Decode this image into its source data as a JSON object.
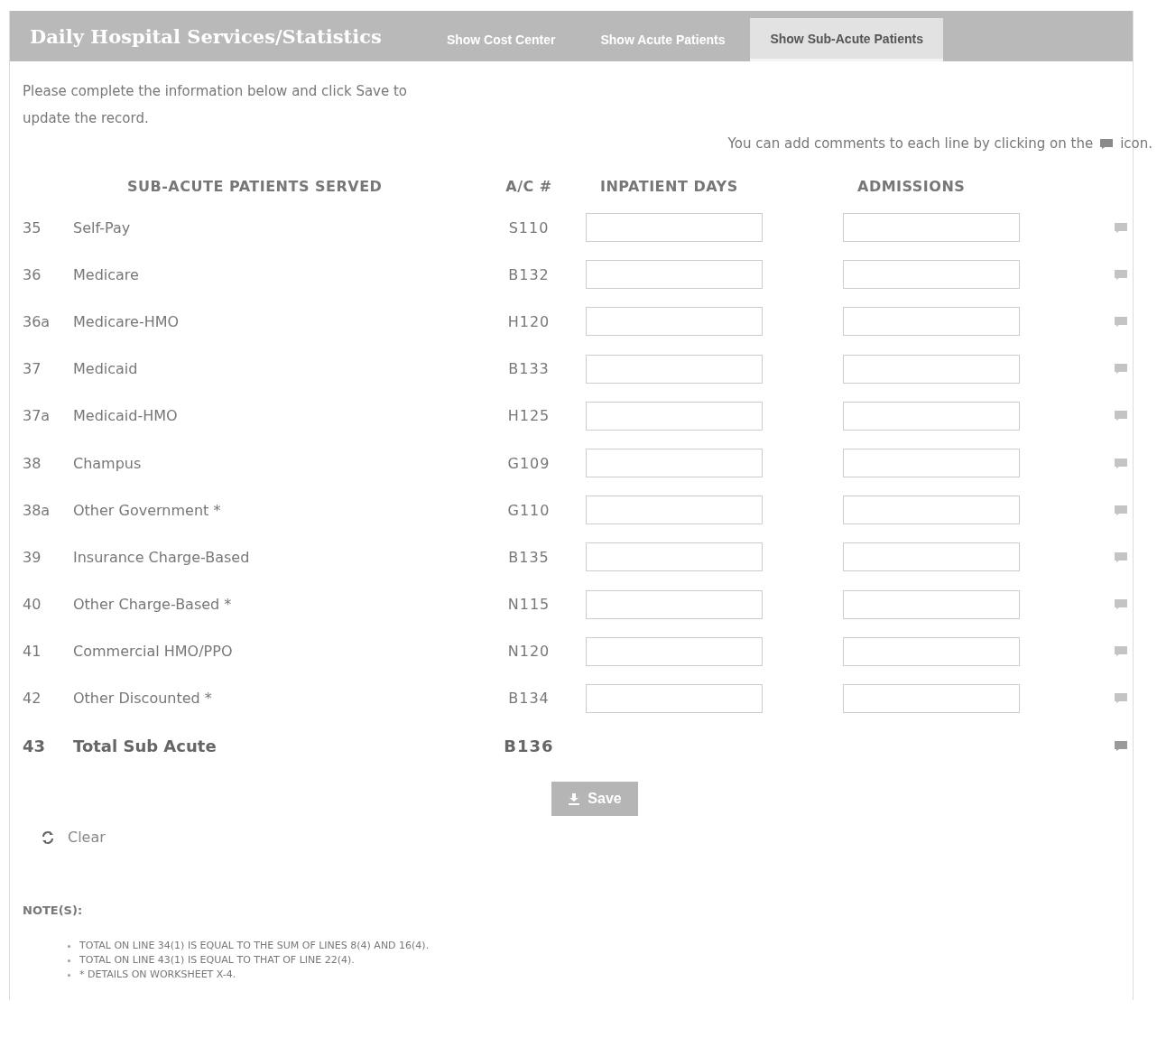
{
  "header": {
    "title": "Daily Hospital Services/Statistics",
    "tabs": [
      {
        "label": "Show Cost Center",
        "selected": false
      },
      {
        "label": "Show Acute Patients",
        "selected": false
      },
      {
        "label": "Show Sub-Acute Patients",
        "selected": true
      }
    ]
  },
  "intro": "Please complete the information below and click Save to update the record.",
  "hint": {
    "before": "You can add comments to each line by clicking on the",
    "after": "icon."
  },
  "table": {
    "columns": [
      "SUB-ACUTE PATIENTS SERVED",
      "A/C #",
      "INPATIENT DAYS",
      "ADMISSIONS"
    ],
    "rows": [
      {
        "kind": "entry",
        "line": "35",
        "name": "Self-Pay",
        "ac": "S110"
      },
      {
        "kind": "entry",
        "line": "36",
        "name": "Medicare",
        "ac": "B132"
      },
      {
        "kind": "entry",
        "line": "36a",
        "name": "Medicare-HMO",
        "ac": "H120"
      },
      {
        "kind": "entry",
        "line": "37",
        "name": "Medicaid",
        "ac": "B133"
      },
      {
        "kind": "entry",
        "line": "37a",
        "name": "Medicaid-HMO",
        "ac": "H125"
      },
      {
        "kind": "entry",
        "line": "38",
        "name": "Champus",
        "ac": "G109"
      },
      {
        "kind": "entry",
        "line": "38a",
        "name": "Other Government *",
        "ac": "G110"
      },
      {
        "kind": "entry",
        "line": "39",
        "name": "Insurance Charge-Based",
        "ac": "B135"
      },
      {
        "kind": "entry",
        "line": "40",
        "name": "Other Charge-Based *",
        "ac": "N115"
      },
      {
        "kind": "entry",
        "line": "41",
        "name": "Commercial HMO/PPO",
        "ac": "N120"
      },
      {
        "kind": "entry",
        "line": "42",
        "name": "Other Discounted *",
        "ac": "B134"
      },
      {
        "kind": "total",
        "line": "43",
        "name": "Total Sub Acute",
        "ac": "B136"
      }
    ]
  },
  "save_button": "Save",
  "clear_button": "Clear",
  "notes": {
    "title": "NOTE(S):",
    "items": [
      "TOTAL ON LINE 34(1) IS EQUAL TO THE SUM OF LINES 8(4) AND 16(4).",
      "TOTAL ON LINE 43(1) IS EQUAL TO THAT OF LINE 22(4).",
      "* DETAILS ON WORKSHEET X-4."
    ]
  }
}
